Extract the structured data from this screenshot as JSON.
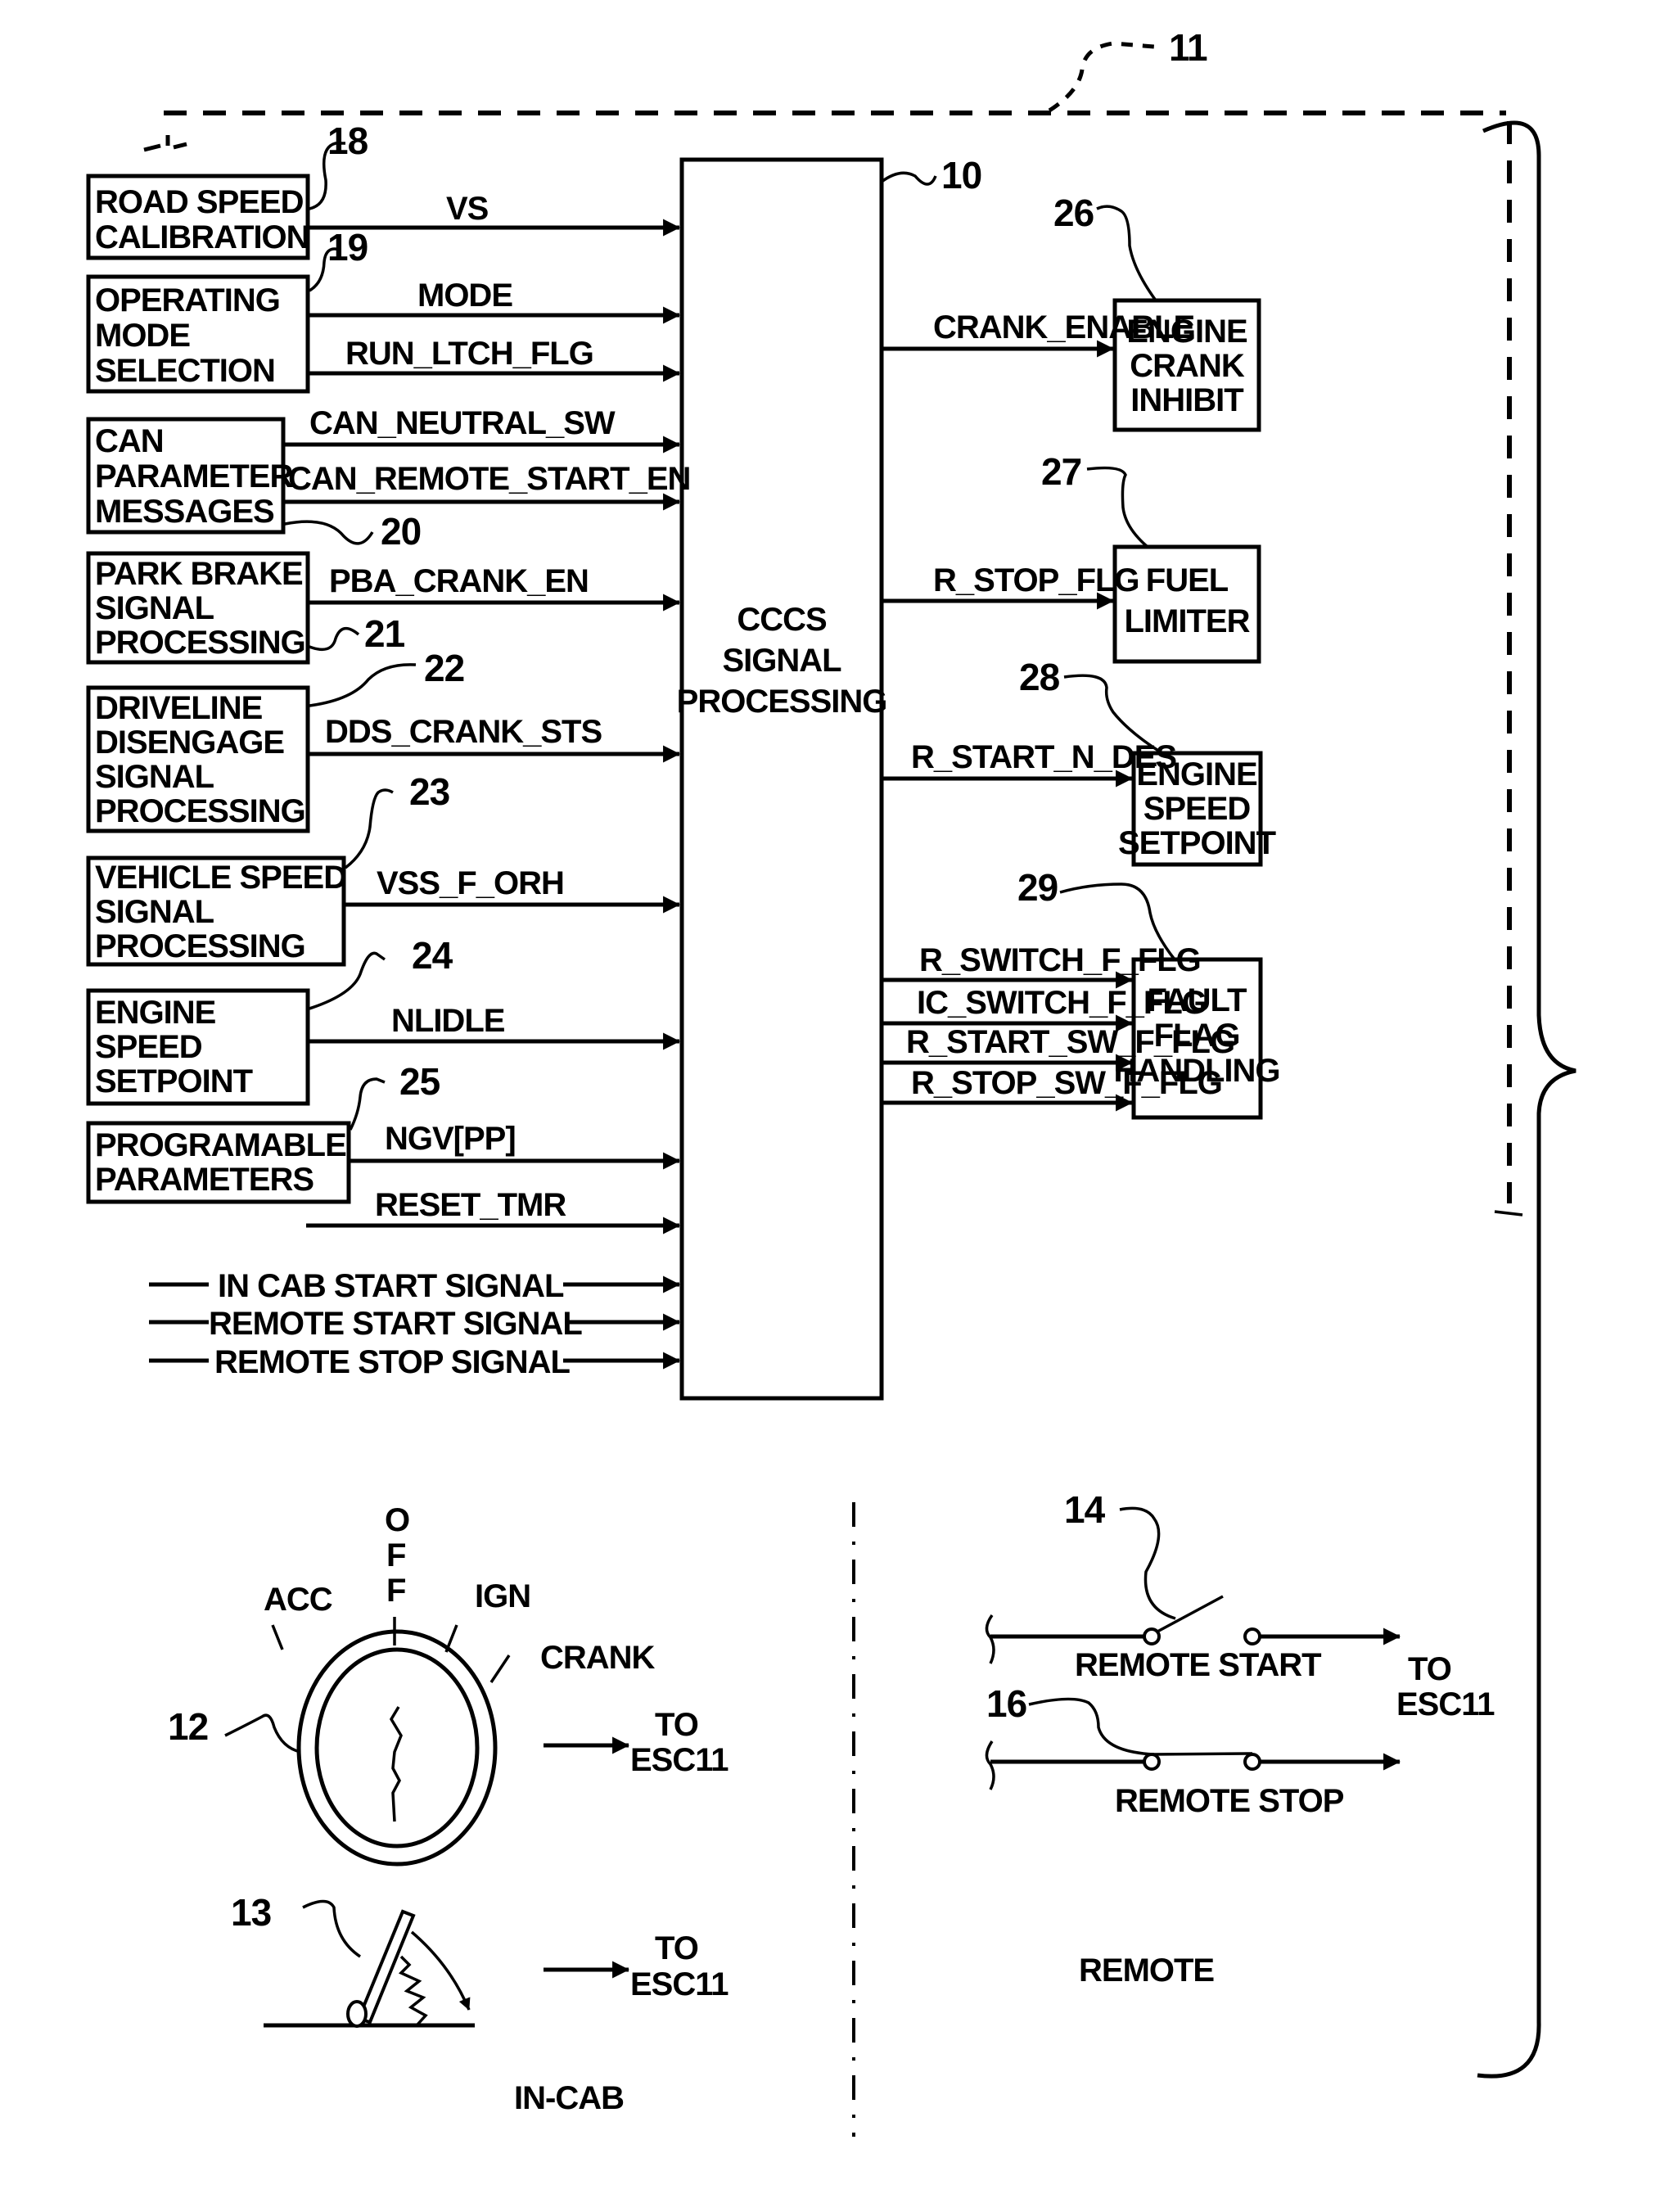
{
  "figure": {
    "system_ref": "11",
    "processor": {
      "ref": "10",
      "lines": [
        "CCCS",
        "SIGNAL",
        "PROCESSING"
      ]
    },
    "inputs": [
      {
        "ref": "18",
        "lines": [
          "ROAD SPEED",
          "CALIBRATION"
        ],
        "signals": [
          "VS"
        ]
      },
      {
        "ref": "19",
        "lines": [
          "OPERATING",
          "MODE",
          "SELECTION"
        ],
        "signals": [
          "MODE",
          "RUN_LTCH_FLG"
        ]
      },
      {
        "ref": "20",
        "lines": [
          "CAN",
          "PARAMETER",
          "MESSAGES"
        ],
        "signals": [
          "CAN_NEUTRAL_SW",
          "CAN_REMOTE_START_EN"
        ]
      },
      {
        "ref": "21",
        "lines": [
          "PARK BRAKE",
          "SIGNAL",
          "PROCESSING"
        ],
        "signals": [
          "PBA_CRANK_EN"
        ]
      },
      {
        "ref": "22",
        "lines": [
          "DRIVELINE",
          "DISENGAGE",
          "SIGNAL",
          "PROCESSING"
        ],
        "signals": [
          "DDS_CRANK_STS"
        ]
      },
      {
        "ref": "23",
        "lines": [
          "VEHICLE SPEED",
          "SIGNAL",
          "PROCESSING"
        ],
        "signals": [
          "VSS_F_ORH"
        ]
      },
      {
        "ref": "24",
        "lines": [
          "ENGINE",
          "SPEED",
          "SETPOINT"
        ],
        "signals": [
          "NLIDLE"
        ]
      },
      {
        "ref": "25",
        "lines": [
          "PROGRAMABLE",
          "PARAMETERS"
        ],
        "signals": [
          "NGV[PP]"
        ]
      }
    ],
    "loose_inputs": [
      "RESET_TMR",
      "IN CAB START SIGNAL",
      "REMOTE START SIGNAL",
      "REMOTE STOP SIGNAL"
    ],
    "outputs": [
      {
        "ref": "26",
        "lines": [
          "ENGINE",
          "CRANK",
          "INHIBIT"
        ],
        "signals": [
          "CRANK_ENABLE"
        ]
      },
      {
        "ref": "27",
        "lines": [
          "FUEL",
          "LIMITER"
        ],
        "signals": [
          "R_STOP_FLG"
        ]
      },
      {
        "ref": "28",
        "lines": [
          "ENGINE",
          "SPEED",
          "SETPOINT"
        ],
        "signals": [
          "R_START_N_DES"
        ]
      },
      {
        "ref": "29",
        "lines": [
          "FAULT",
          "FLAG",
          "HANDLING"
        ],
        "signals": [
          "R_SWITCH_F_FLG",
          "IC_SWITCH_F_FLG",
          "R_START_SW_F_FLG",
          "R_STOP_SW_F_FLG"
        ]
      }
    ],
    "in_cab": {
      "section_label": "IN-CAB",
      "ignition_switch": {
        "ref": "12",
        "positions": [
          "ACC",
          "OFF",
          "IGN",
          "CRANK"
        ],
        "to_label": [
          "TO",
          "ESC11"
        ]
      },
      "pedal": {
        "ref": "13",
        "to_label": [
          "TO",
          "ESC11"
        ]
      }
    },
    "remote": {
      "section_label": "REMOTE",
      "start_switch": {
        "ref": "14",
        "label": "REMOTE START"
      },
      "stop_switch": {
        "ref": "16",
        "label": "REMOTE STOP"
      },
      "to_label": [
        "TO",
        "ESC11"
      ]
    }
  }
}
